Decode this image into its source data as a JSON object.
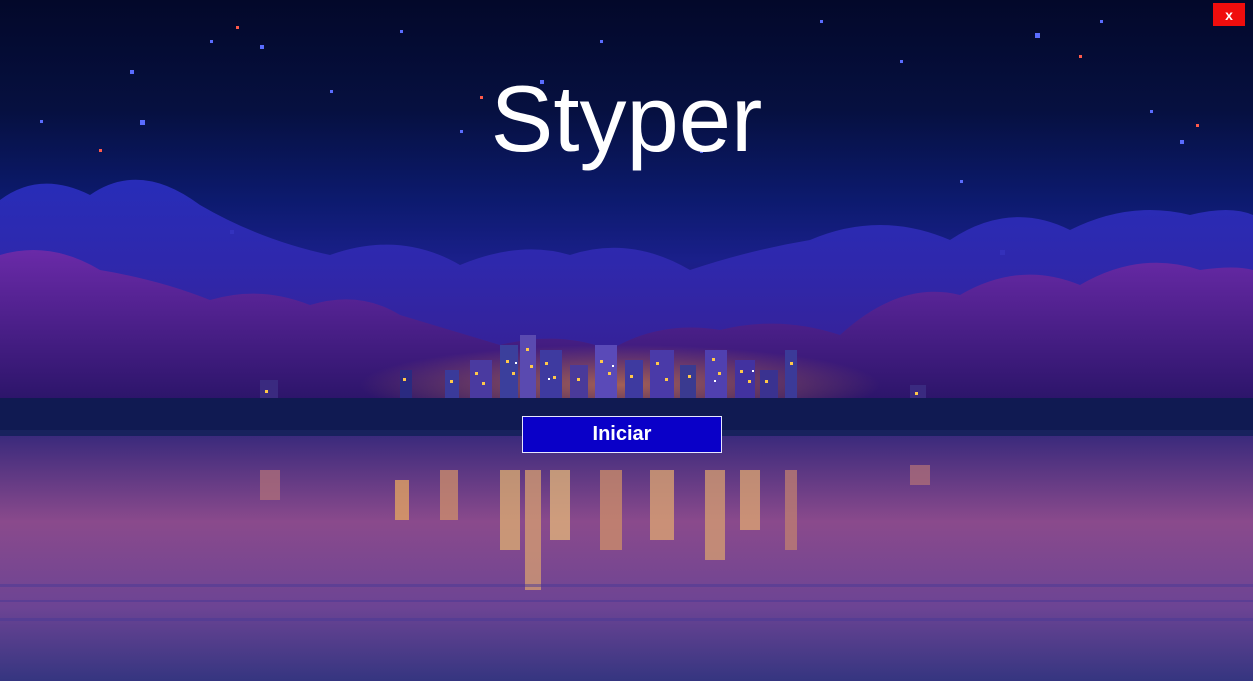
{
  "app": {
    "title": "Styper",
    "start_label": "Iniciar",
    "close_label": "x"
  },
  "icons": {
    "close": "close-icon"
  },
  "colors": {
    "close_bg": "#f00d0d",
    "start_bg": "#0a00c8",
    "title_text": "#ffffff"
  }
}
